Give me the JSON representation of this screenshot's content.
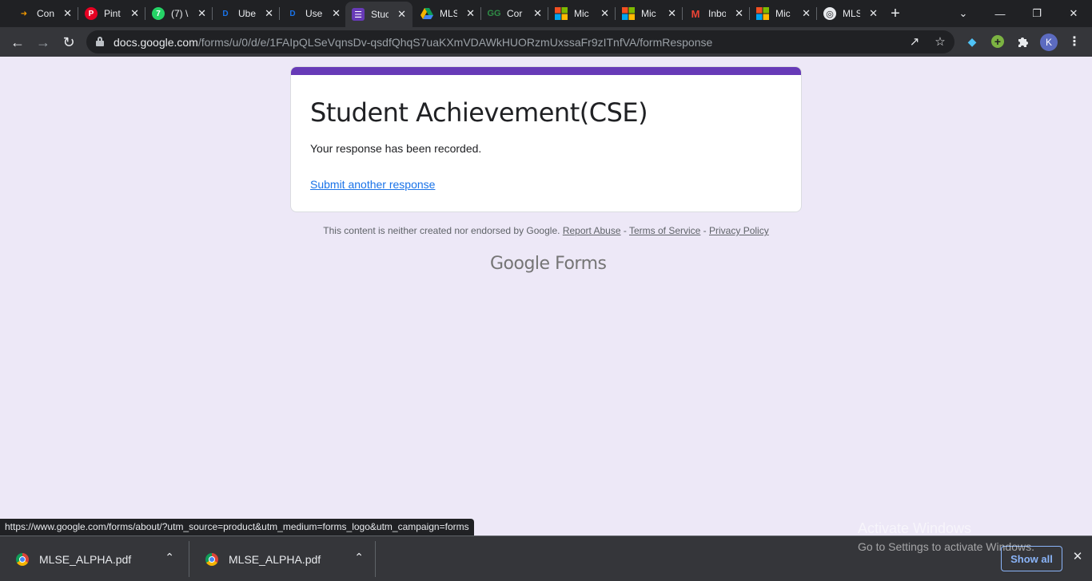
{
  "tabs": [
    {
      "label": "Con",
      "icon": "arrow-logo-icon",
      "active": false
    },
    {
      "label": "Pint",
      "icon": "pinterest-icon",
      "active": false
    },
    {
      "label": "(7) \\",
      "icon": "whatsapp-icon",
      "active": false
    },
    {
      "label": "Ube",
      "icon": "dc-logo-icon",
      "active": false
    },
    {
      "label": "Use",
      "icon": "dc-logo-icon",
      "active": false
    },
    {
      "label": "Stuc",
      "icon": "google-forms-icon",
      "active": true
    },
    {
      "label": "MLS",
      "icon": "google-drive-icon",
      "active": false
    },
    {
      "label": "Cor",
      "icon": "geeksforgeeks-icon",
      "active": false
    },
    {
      "label": "Mic",
      "icon": "microsoft-icon",
      "active": false
    },
    {
      "label": "Mic",
      "icon": "microsoft-icon",
      "active": false
    },
    {
      "label": "Inbo",
      "icon": "gmail-icon",
      "active": false
    },
    {
      "label": "Mic",
      "icon": "microsoft-icon",
      "active": false
    },
    {
      "label": "MLS",
      "icon": "globe-icon",
      "active": false
    }
  ],
  "address_bar": {
    "host": "docs.google.com",
    "path": "/forms/u/0/d/e/1FAIpQLSeVqnsDv-qsdfQhqS7uaKXmVDAWkHUORzmUxssaFr9zITnfVA/formResponse"
  },
  "profile": {
    "initial": "K"
  },
  "form": {
    "title": "Student Achievement(CSE)",
    "confirmation": "Your response has been recorded.",
    "another_link": "Submit another response",
    "accent_color": "#673ab7"
  },
  "footer": {
    "disclaimer": "This content is neither created nor endorsed by Google.",
    "report_abuse": "Report Abuse",
    "sep1": " - ",
    "terms": "Terms of Service",
    "sep2": " - ",
    "privacy": "Privacy Policy",
    "logo_google": "Google",
    "logo_forms": "Forms"
  },
  "status_url": "https://www.google.com/forms/about/?utm_source=product&utm_medium=forms_logo&utm_campaign=forms",
  "watermark": {
    "line1": "Activate Windows",
    "line2": "Go to Settings to activate Windows."
  },
  "downloads": [
    {
      "filename": "MLSE_ALPHA.pdf"
    },
    {
      "filename": "MLSE_ALPHA.pdf"
    }
  ],
  "show_all_label": "Show all",
  "background_color": "#ede8f7"
}
